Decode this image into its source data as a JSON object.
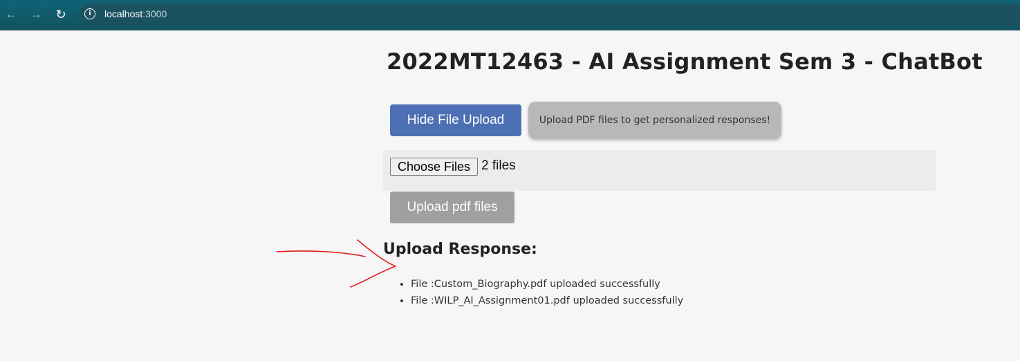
{
  "browser": {
    "url_host": "localhost",
    "url_port": ":3000",
    "back_icon": "back-arrow-icon",
    "forward_icon": "forward-arrow-icon",
    "reload_icon": "reload-icon",
    "info_icon": "info-icon"
  },
  "page": {
    "title": "2022MT12463 - AI Assignment Sem 3 - ChatBot",
    "toggle_upload_label": "Hide File Upload",
    "hint_text": "Upload PDF files to get personalized responses!",
    "file_input": {
      "choose_label": "Choose Files",
      "selected_text": "2 files"
    },
    "upload_button_label": "Upload pdf files",
    "response": {
      "heading": "Upload Response:",
      "items": [
        "File :Custom_Biography.pdf uploaded successfully",
        "File :WILP_AI_Assignment01.pdf uploaded successfully"
      ]
    }
  },
  "colors": {
    "toolbar": "#13535f",
    "page_background": "#f6f6f6",
    "primary_button": "#4c70b3",
    "disabled_button": "#a0a0a0",
    "hint_background": "#b8b8b8",
    "annotation_stroke": "#e11b1b"
  }
}
